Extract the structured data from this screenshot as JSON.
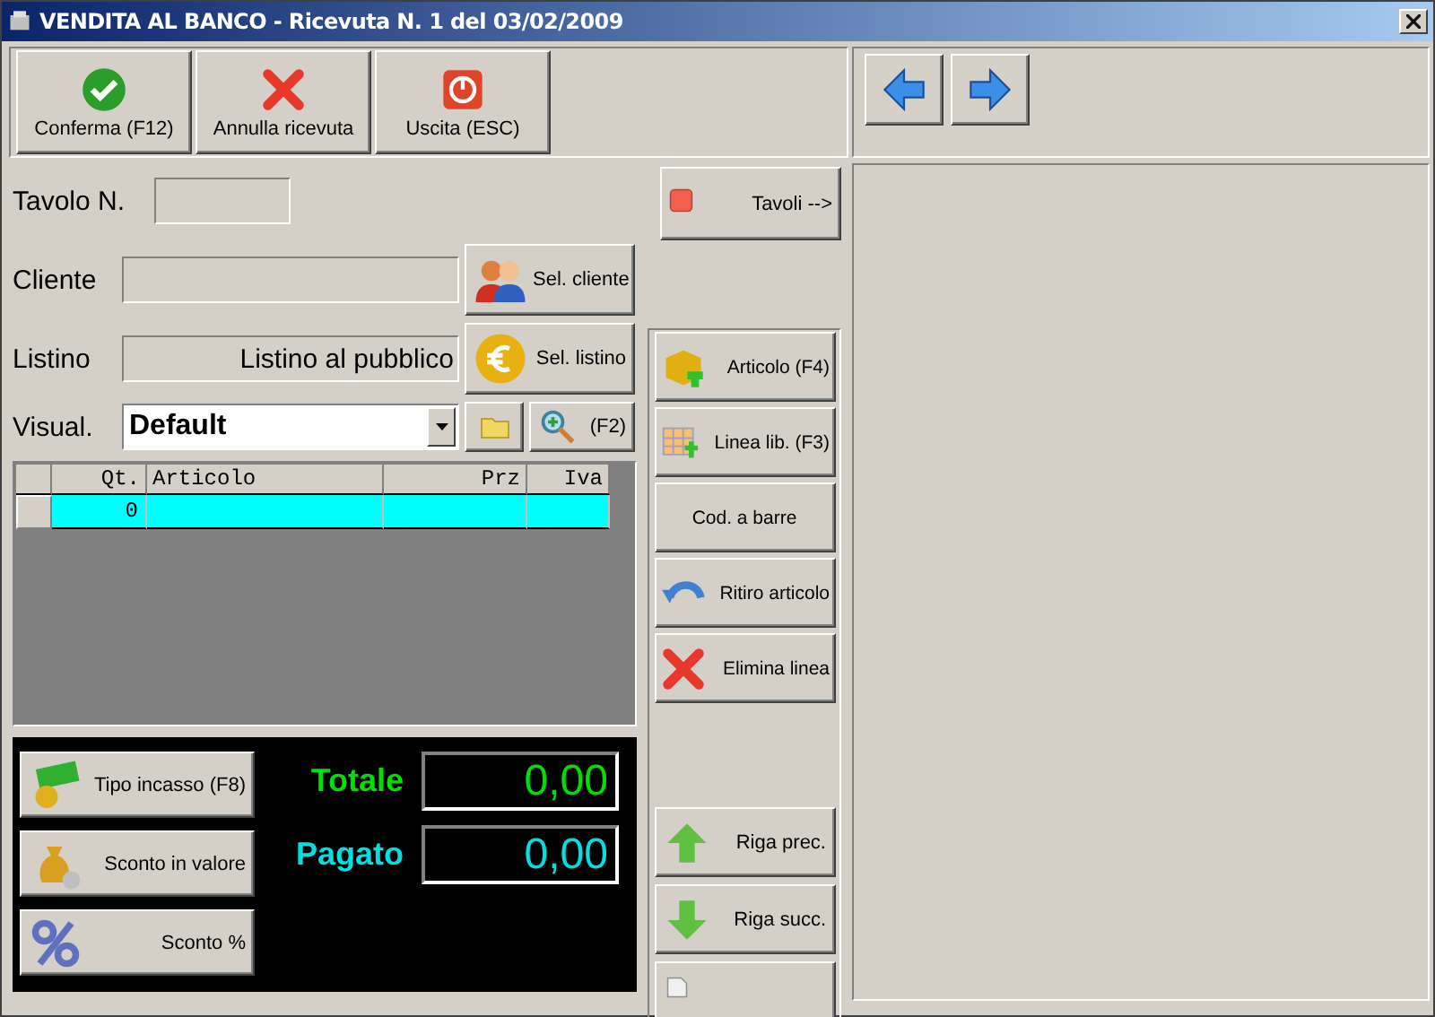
{
  "window": {
    "title": "VENDITA AL BANCO - Ricevuta N. 1 del 03/02/2009"
  },
  "toolbar": [
    "Conferma (F12)",
    "Annulla ricevuta",
    "Uscita (ESC)"
  ],
  "form": {
    "tavolo": {
      "label": "Tavolo N."
    },
    "cliente": {
      "label": "Cliente"
    },
    "listino": {
      "label": "Listino",
      "value": "Listino al pubblico"
    },
    "visual": {
      "label": "Visual.",
      "value": "Default"
    }
  },
  "tavoli_button": "Tavoli -->",
  "select_buttons": [
    "Sel. cliente",
    "Sel. listino"
  ],
  "search_button": "(F2)",
  "table": {
    "columns": [
      "Qt.",
      "Articolo",
      "Prz",
      "Iva"
    ],
    "rows": [
      {
        "qt": "0",
        "selected": true
      }
    ]
  },
  "payment_buttons": [
    "Tipo incasso (F8)",
    "Sconto in valore",
    "Sconto %"
  ],
  "totals": [
    {
      "label": "Totale",
      "value": "0,00",
      "color": "#00e000"
    },
    {
      "label": "Pagato",
      "value": "0,00",
      "color": "#00e0e0"
    }
  ],
  "line_buttons": [
    "Articolo (F4)",
    "Linea lib. (F3)",
    "Cod. a barre",
    "Ritiro articolo",
    "Elimina linea"
  ],
  "row_buttons": [
    "Riga prec.",
    "Riga succ."
  ]
}
